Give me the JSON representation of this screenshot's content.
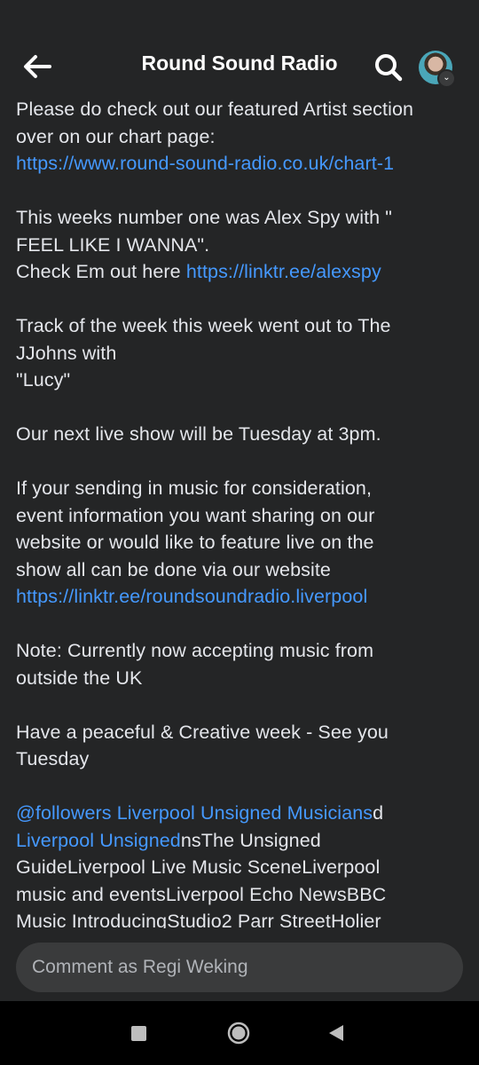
{
  "header": {
    "title": "Round Sound Radio"
  },
  "post": {
    "p1": {
      "l1": "Please do check out our featured Artist section",
      "l2": "over on our chart page:",
      "link": "https://www.round-sound-radio.co.uk/chart-1"
    },
    "p2": {
      "l1": "This weeks number one was Alex Spy  with \"",
      "l2": "FEEL  LIKE I WANNA\".",
      "l3_text": "Check Em out here ",
      "l3_link": "https://linktr.ee/alexspy"
    },
    "p3": {
      "l1": "Track of the week this week went out to The",
      "l2": "JJohns  with",
      "l3": "\"Lucy\""
    },
    "p4": {
      "l1": "Our next live show will be Tuesday at 3pm."
    },
    "p5": {
      "l1": "If your sending in music for consideration,",
      "l2": "event information you want sharing on our",
      "l3": "website or would like to feature live on the",
      "l4": "show all can be done via our website",
      "link": "https://linktr.ee/roundsoundradio.liverpool"
    },
    "p6": {
      "l1": "Note: Currently now accepting music from",
      "l2": "outside the UK"
    },
    "p7": {
      "l1": "Have a peaceful & Creative week - See you",
      "l2": "Tuesday"
    },
    "tags": {
      "l1_link": "@followers Liverpool Unsigned Musicians",
      "l1_text": "d",
      "l2_link": "Liverpool Unsigned",
      "l2_text": "nsThe Unsigned",
      "l3": "GuideLiverpool Live Music SceneLiverpool",
      "l4": "music and eventsLiverpool Echo NewsBBC",
      "l5": "Music IntroducingStudio2 Parr StreetHolier"
    }
  },
  "comment": {
    "placeholder": "Comment as Regi Weking"
  },
  "icons": {
    "back": "arrow-left-icon",
    "search": "search-icon",
    "avatar": "profile-avatar",
    "badge": "chevron-down-icon"
  },
  "colors": {
    "background": "#242526",
    "link": "#4599ff",
    "text": "#e4e6eb",
    "input": "#3a3b3c"
  }
}
